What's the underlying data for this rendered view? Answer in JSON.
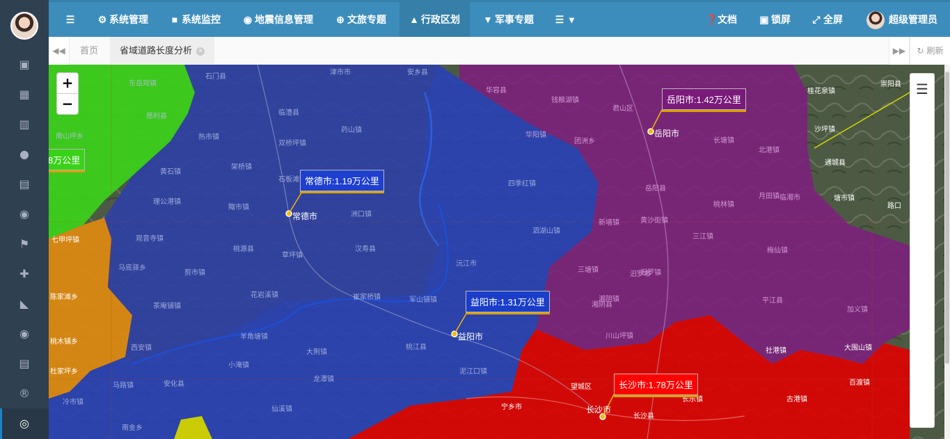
{
  "sidebar": {
    "icons": [
      "window-maximize-icon",
      "object-group-icon",
      "map-icon",
      "map-marker-icon",
      "bar-chart-icon",
      "globe-icon",
      "flag-checkered-icon",
      "arrows-icon",
      "area-chart-icon",
      "globe-2-icon",
      "bar-chart-2-icon",
      "registered-icon",
      "life-ring-icon"
    ]
  },
  "topnav": {
    "menu_icon": "bars-icon",
    "items": [
      {
        "label": "系统管理",
        "icon": "gear-icon"
      },
      {
        "label": "系统监控",
        "icon": "video-icon"
      },
      {
        "label": "地震信息管理",
        "icon": "map-marker-icon"
      },
      {
        "label": "文旅专题",
        "icon": "globe-icon"
      },
      {
        "label": "行政区划",
        "icon": "institution-icon"
      },
      {
        "label": "军事专题",
        "icon": "shield-icon"
      }
    ],
    "more_icon": "list-dropdown-icon",
    "right": {
      "docs": "文档",
      "lock": "锁屏",
      "fullscreen": "全屏",
      "user": "超级管理员"
    }
  },
  "tabs": {
    "items": [
      {
        "label": "首页"
      },
      {
        "label": "省域道路长度分析"
      }
    ],
    "refresh": "刷新"
  },
  "map": {
    "zoom_in": "+",
    "zoom_out": "−",
    "layer_icon": "layers-icon",
    "cities": [
      {
        "name": "常德市:1.19万公里",
        "color": "#2740b8"
      },
      {
        "name": "岳阳市:1.42万公里",
        "color": "#7a1a7a"
      },
      {
        "name": "益阳市:1.31万公里",
        "color": "#1a3ec9"
      },
      {
        "name": "长沙市:1.78万公里",
        "color": "#e00000"
      },
      {
        "name": "8万公里",
        "color": "#3ad11a"
      }
    ],
    "city_markers": [
      "常德市",
      "岳阳市",
      "益阳市",
      "长沙市"
    ],
    "places": [
      "石门县",
      "津市市",
      "安乡县",
      "慈利县",
      "临澧县",
      "东岳观镇",
      "南山坪乡",
      "热市镇",
      "双桥坪镇",
      "药山镇",
      "黄石镇",
      "架桥镇",
      "石板滩镇",
      "理公港镇",
      "陬市镇",
      "洲口镇",
      "汉寿县",
      "观音寺镇",
      "桃源县",
      "草坪镇",
      "七甲坪镇",
      "马底驿乡",
      "茶庵铺镇",
      "剪市镇",
      "花岩溪镇",
      "崔家桥镇",
      "军山铺镇",
      "沅江市",
      "四季红镇",
      "泗湖山镇",
      "华容县",
      "钱粮湖镇",
      "君山区",
      "团洲乡",
      "华阳镇",
      "岳阳县",
      "长塘镇",
      "北港镇",
      "临湘市",
      "黄沙街镇",
      "新墙镇",
      "湘阴县",
      "汨罗市",
      "三江镇",
      "梅仙镇",
      "平江县",
      "加义镇",
      "桃江县",
      "泥江口镇",
      "宁乡市",
      "长沙县",
      "望城区",
      "大围山镇",
      "百渡镇",
      "古港镇",
      "羊角塘镇",
      "小淹镇",
      "安化县",
      "马路镇",
      "冷市镇",
      "南金乡",
      "仙溪镇",
      "杜家坪乡",
      "桃木铺乡",
      "西安镇",
      "陈家滩乡",
      "崇阳县",
      "通城县",
      "桂花泉镇",
      "沙坪镇",
      "塘市镇",
      "路口",
      "月田镇",
      "汨罗镇",
      "三塘镇",
      "湘阴镇",
      "川山坪镇",
      "社港镇",
      "长乐镇",
      "桃林镇",
      "大荆镇",
      "龙潭镇"
    ]
  },
  "colors": {
    "sidebar": "#2f4050",
    "topnav": "#3c8dbc",
    "changde": "#2c3fa8",
    "yueyang": "#7d1f7d",
    "changsha": "#e00000",
    "zhangjiajie": "#3bd11a",
    "huaihua": "#e08a10"
  }
}
